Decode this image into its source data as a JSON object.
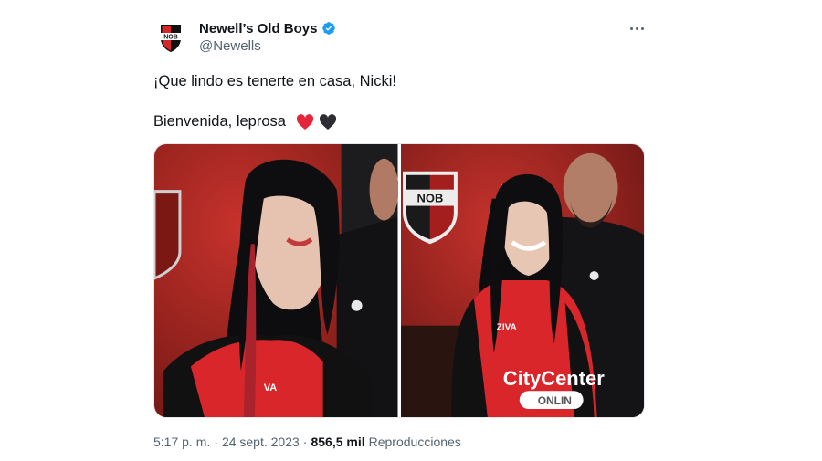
{
  "author": {
    "name": "Newell’s Old Boys",
    "handle": "@Newells",
    "verified": true,
    "avatar_text": "NOB"
  },
  "tweet": {
    "line1": "¡Que lindo es tenerte en casa, Nicki!",
    "line2": "Bienvenida, leprosa",
    "emojis": [
      "red-heart",
      "black-heart"
    ]
  },
  "media": {
    "photo1": {
      "shirt_text": "VA"
    },
    "photo2": {
      "badge_text": "NOB",
      "sponsor_text": "CityCenter",
      "sponsor_sub": "ONLIN",
      "shirt_text": "ZIVA"
    }
  },
  "meta": {
    "time": "5:17 p. m.",
    "sep": "·",
    "date": "24 sept. 2023",
    "views_count": "856,5 mil",
    "views_label": "Reproducciones"
  },
  "colors": {
    "verified": "#1d9bf0",
    "secondary_text": "#536471",
    "club_red": "#d6262a"
  }
}
